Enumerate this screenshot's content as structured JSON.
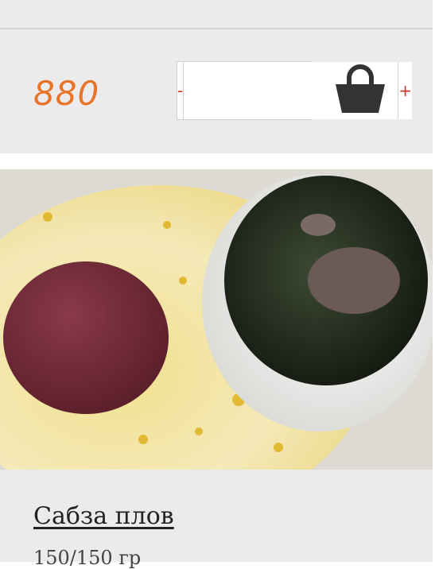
{
  "product": {
    "price": "880",
    "quantity": "",
    "minus_label": "-",
    "plus_label": "+",
    "cart_icon": "shopping-bag-icon",
    "image_description": "",
    "title": "Сабза плов",
    "weight": "150/150 гр"
  },
  "colors": {
    "price": "#e8742a",
    "stepper_sign": "#c0392b",
    "card_bg": "#ebebeb",
    "cart_icon": "#333333"
  }
}
